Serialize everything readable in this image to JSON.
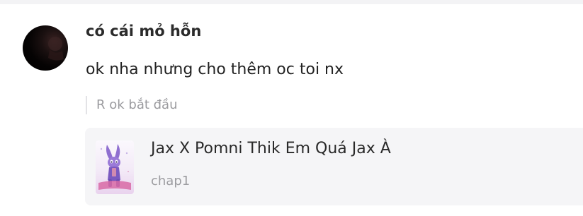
{
  "comment": {
    "author": "có cái mỏ hỗn",
    "text": "ok nha nhưng cho thêm oc toi nx",
    "reply_quote": "R ok bắt đầu"
  },
  "story_card": {
    "title": "Jax X Pomni Thik Em Quá Jax À",
    "subtitle": "chap1"
  },
  "colors": {
    "card_background": "#f5f5f7",
    "muted_text": "#9a9a9e",
    "primary_text": "#222222"
  }
}
